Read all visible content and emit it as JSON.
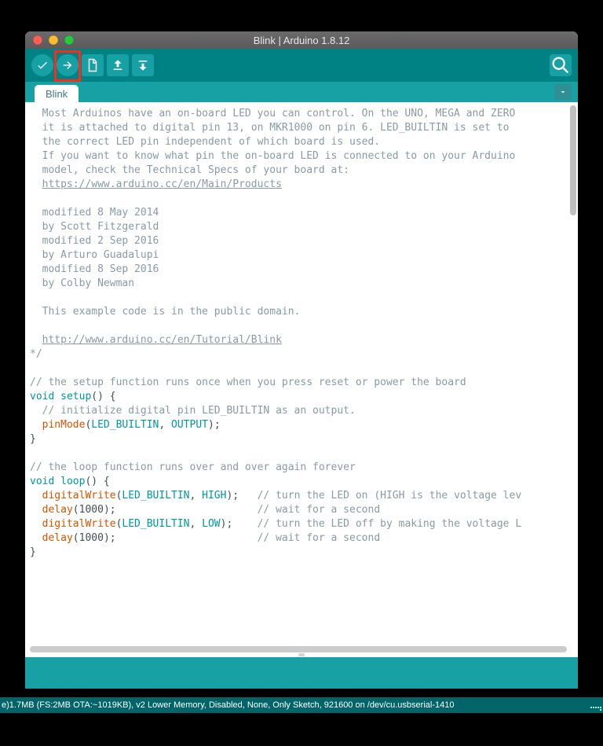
{
  "window": {
    "title": "Blink | Arduino 1.8.12"
  },
  "toolbar": {
    "verify_tip": "Verify",
    "upload_tip": "Upload",
    "new_tip": "New",
    "open_tip": "Open",
    "save_tip": "Save",
    "serial_tip": "Serial Monitor"
  },
  "tabs": {
    "active": "Blink"
  },
  "code": {
    "header_comment_lines": [
      "  Most Arduinos have an on-board LED you can control. On the UNO, MEGA and ZERO",
      "  it is attached to digital pin 13, on MKR1000 on pin 6. LED_BUILTIN is set to",
      "  the correct LED pin independent of which board is used.",
      "  If you want to know what pin the on-board LED is connected to on your Arduino",
      "  model, check the Technical Specs of your board at:"
    ],
    "link1_indent": "  ",
    "link1": "https://www.arduino.cc/en/Main/Products",
    "blank1": "",
    "mod_lines": [
      "  modified 8 May 2014",
      "  by Scott Fitzgerald",
      "  modified 2 Sep 2016",
      "  by Arturo Guadalupi",
      "  modified 8 Sep 2016",
      "  by Colby Newman"
    ],
    "blank2": "",
    "public_domain": "  This example code is in the public domain.",
    "blank3": "",
    "link2_indent": "  ",
    "link2": "http://www.arduino.cc/en/Tutorial/Blink",
    "end_block": "*/",
    "blank4": "",
    "setup_comment": "// the setup function runs once when you press reset or power the board",
    "void1": "void",
    "setup_name": " setup",
    "setup_paren": "() {",
    "init_comment": "  // initialize digital pin LED_BUILTIN as an output.",
    "pinMode_indent": "  ",
    "pinMode": "pinMode",
    "pinMode_open": "(",
    "LED_BUILTIN1": "LED_BUILTIN",
    "comma1": ", ",
    "OUTPUT": "OUTPUT",
    "close1": ");",
    "brace_close1": "}",
    "blank5": "",
    "loop_comment": "// the loop function runs over and over again forever",
    "void2": "void",
    "loop_name": " loop",
    "loop_paren": "() {",
    "dw_indent": "  ",
    "digitalWrite1": "digitalWrite",
    "dw1_open": "(",
    "LED_BUILTIN2": "LED_BUILTIN",
    "comma2": ", ",
    "HIGH": "HIGH",
    "dw1_close": ");   ",
    "dw1_cmt": "// turn the LED on (HIGH is the voltage lev",
    "delay1_indent": "  ",
    "delay1": "delay",
    "delay1_open": "(",
    "num1": "1000",
    "delay1_close": ");                       ",
    "delay1_cmt": "// wait for a second",
    "digitalWrite2": "digitalWrite",
    "dw2_open": "(",
    "LED_BUILTIN3": "LED_BUILTIN",
    "comma3": ", ",
    "LOW": "LOW",
    "dw2_close": ");    ",
    "dw2_cmt": "// turn the LED off by making the voltage L",
    "delay2_indent": "  ",
    "delay2": "delay",
    "delay2_open": "(",
    "num2": "1000",
    "delay2_close": ");                       ",
    "delay2_cmt": "// wait for a second",
    "brace_close2": "}"
  },
  "status": {
    "text": "e)1.7MB (FS:2MB OTA:~1019KB), v2 Lower Memory, Disabled, None, Only Sketch, 921600 on /dev/cu.usbserial-1410"
  }
}
